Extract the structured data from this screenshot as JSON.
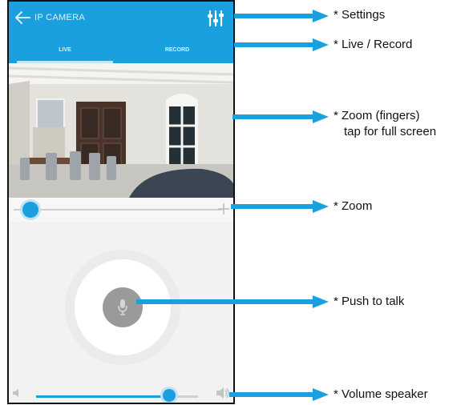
{
  "app": {
    "title": "IP CAMERA",
    "accent_color": "#1aa0de",
    "tabs": [
      {
        "label": "LIVE",
        "active": true
      },
      {
        "label": "RECORD",
        "active": false
      }
    ],
    "back_icon": "arrow-left-icon",
    "settings_icon": "sliders-icon"
  },
  "zoom": {
    "level": 0.08,
    "plus_icon": "plus-icon"
  },
  "talk": {
    "icon": "microphone-icon"
  },
  "volume": {
    "level": 0.82,
    "low_icon": "speaker-low-icon",
    "high_icon": "speaker-high-icon"
  },
  "annotations": [
    {
      "text": "* Settings"
    },
    {
      "text": "* Live / Record"
    },
    {
      "text": "* Zoom (fingers)"
    },
    {
      "text": "tap for full screen"
    },
    {
      "text": "* Zoom"
    },
    {
      "text": "* Push to talk"
    },
    {
      "text": "* Volume speaker"
    }
  ]
}
